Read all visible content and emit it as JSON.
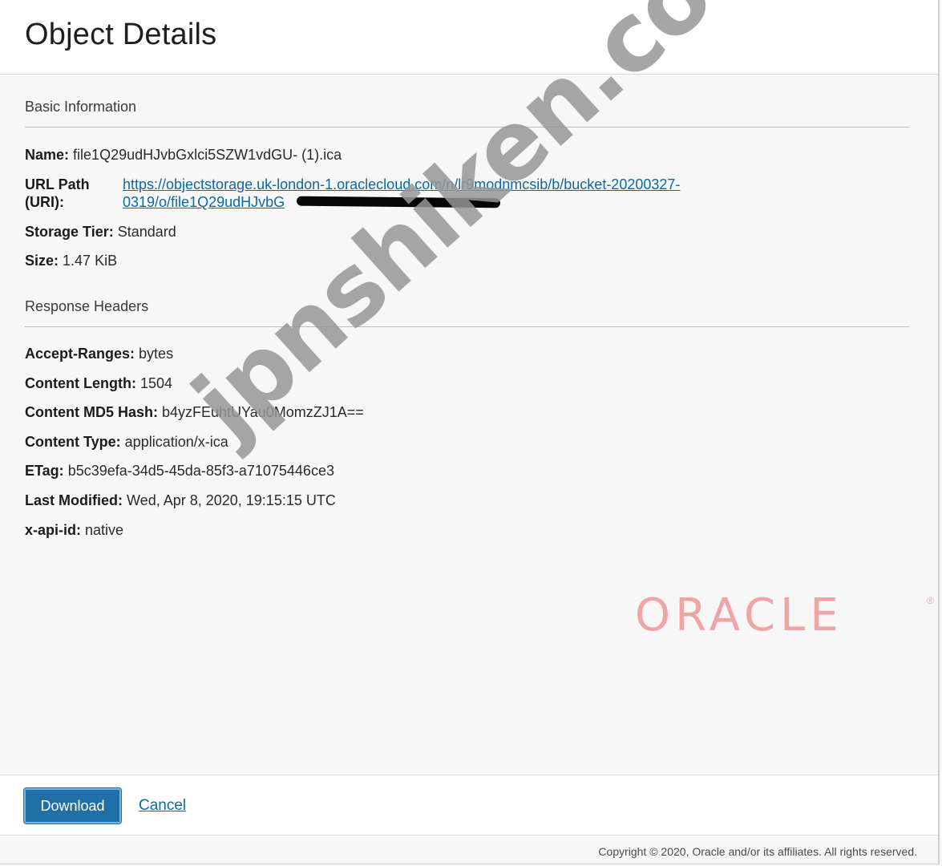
{
  "header": {
    "title": "Object Details"
  },
  "basic_info": {
    "section_title": "Basic Information",
    "name_label": "Name:",
    "name_value": "file1Q29udHJvbGxlci5SZW1vdGU- (1).ica",
    "url_label_line1": "URL Path",
    "url_label_line2": "(URI):",
    "url_line1": "https://objectstorage.uk-london-1.oraclecloud.com/n/lr9modnmcsib/b/bucket-20200327-",
    "url_line2": "0319/o/file1Q29udHJvbG",
    "storage_tier_label": "Storage Tier:",
    "storage_tier_value": "Standard",
    "size_label": "Size:",
    "size_value": "1.47 KiB"
  },
  "response_headers": {
    "section_title": "Response Headers",
    "rows": [
      {
        "label": "Accept-Ranges:",
        "value": "bytes"
      },
      {
        "label": "Content Length:",
        "value": "1504"
      },
      {
        "label": "Content MD5 Hash:",
        "value": "b4yzFEuhtUYau0MomzZJ1A=="
      },
      {
        "label": "Content Type:",
        "value": "application/x-ica"
      },
      {
        "label": "ETag:",
        "value": "b5c39efa-34d5-45da-85f3-a71075446ce3"
      },
      {
        "label": "Last Modified:",
        "value": "Wed, Apr 8, 2020, 19:15:15 UTC"
      },
      {
        "label": "x-api-id:",
        "value": "native"
      }
    ]
  },
  "logo": {
    "text": "ORACLE",
    "reg": "®",
    "color": "#f0a4a4"
  },
  "watermark": {
    "text": "jpnshiken.com"
  },
  "footer": {
    "download_label": "Download",
    "cancel_label": "Cancel",
    "copyright": "Copyright © 2020, Oracle and/or its affiliates. All rights reserved."
  },
  "colors": {
    "primary_button": "#1f6fa8",
    "link": "#0b6aa3"
  }
}
